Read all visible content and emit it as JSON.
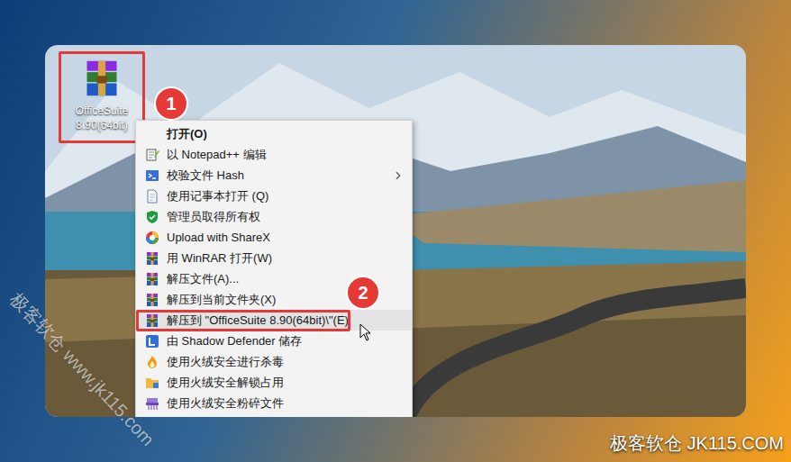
{
  "desktop_icon": {
    "label_lines": [
      "OfficeSuite",
      "8.90(64bit)"
    ],
    "selected": true
  },
  "annotations": [
    {
      "label": "1"
    },
    {
      "label": "2"
    }
  ],
  "context_menu": {
    "items": [
      {
        "label": "打开(O)",
        "bold": true,
        "highlighted": false,
        "submenu": false
      },
      {
        "label": "以 Notepad++ 编辑",
        "bold": false,
        "highlighted": false,
        "submenu": false
      },
      {
        "label": "校验文件 Hash",
        "bold": false,
        "highlighted": false,
        "submenu": true
      },
      {
        "label": "使用记事本打开 (Q)",
        "bold": false,
        "highlighted": false,
        "submenu": false
      },
      {
        "label": "管理员取得所有权",
        "bold": false,
        "highlighted": false,
        "submenu": false
      },
      {
        "label": "Upload with ShareX",
        "bold": false,
        "highlighted": false,
        "submenu": false
      },
      {
        "label": "用 WinRAR 打开(W)",
        "bold": false,
        "highlighted": false,
        "submenu": false
      },
      {
        "label": "解压文件(A)...",
        "bold": false,
        "highlighted": false,
        "submenu": false
      },
      {
        "label": "解压到当前文件夹(X)",
        "bold": false,
        "highlighted": false,
        "submenu": false
      },
      {
        "label": "解压到 \"OfficeSuite 8.90(64bit)\\\"(E)",
        "bold": false,
        "highlighted": true,
        "submenu": false
      },
      {
        "label": "由 Shadow Defender 储存",
        "bold": false,
        "highlighted": false,
        "submenu": false
      },
      {
        "label": "使用火绒安全进行杀毒",
        "bold": false,
        "highlighted": false,
        "submenu": false
      },
      {
        "label": "使用火绒安全解锁占用",
        "bold": false,
        "highlighted": false,
        "submenu": false
      },
      {
        "label": "使用火绒安全粉碎文件",
        "bold": false,
        "highlighted": false,
        "submenu": false
      }
    ]
  },
  "watermarks": {
    "diagonal": "极客软仓 www.jk115.com",
    "corner": "极客软仓 JK115.COM"
  }
}
